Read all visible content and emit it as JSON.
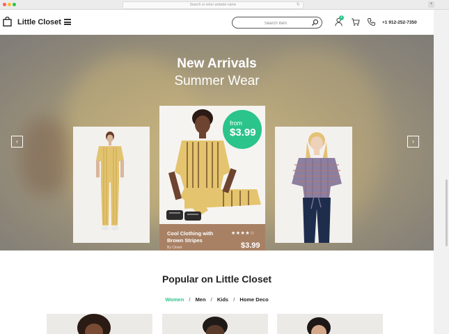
{
  "browser": {
    "address_placeholder": "Search or enter website name",
    "reload_glyph": "↻",
    "extra_button_glyph": "+"
  },
  "header": {
    "brand": "Little Closet",
    "search_placeholder": "Search Item",
    "user_badge": "1",
    "phone": "+1 912-252-7350",
    "accent_color": "#2bc48a"
  },
  "hero": {
    "title": "New Arrivals",
    "subtitle": "Summer Wear",
    "prev_glyph": "‹",
    "next_glyph": "›",
    "price_from": "from",
    "price_value": "$3.99",
    "featured": {
      "name": "Cool Clothing with Brown Stripes",
      "rating_stars": "★★★★☆",
      "price": "$3.99",
      "more": "By Closet"
    }
  },
  "popular": {
    "title": "Popular on Little Closet",
    "filters": [
      "Women",
      "Men",
      "Kids",
      "Home Deco"
    ],
    "active_filter": "Women",
    "separator": "/"
  }
}
